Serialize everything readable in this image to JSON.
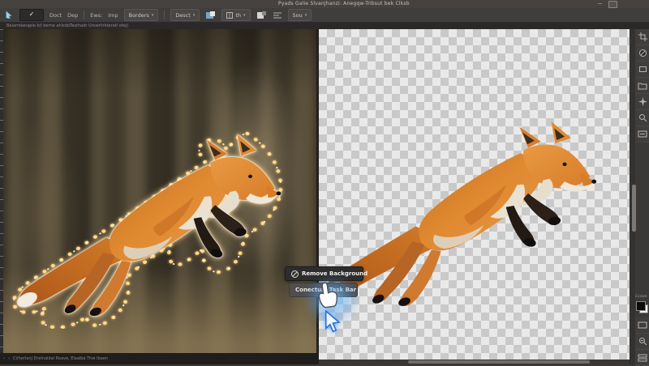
{
  "window": {
    "title": "Pyads Galie Slvanjhanzi: Anegqw-Tribsut bek Clksb",
    "minimize_glyph": "—",
    "maximize_glyph": ""
  },
  "options_bar": {
    "check_glyph": "✓",
    "label_doct": "Doct",
    "label_dep": "Dep",
    "label_ews": "Ews:",
    "label_imp": "Imp",
    "borders_dropdown": "Borders",
    "select_button": "Desct",
    "th_dropdown": "th",
    "sou_dropdown": "Sou",
    "caret": "▾"
  },
  "hint_bar": {
    "text": "Balamdanaple b/l berne ahlstbiTesrhadr Urowrlirkteratl otej)"
  },
  "context_menu": {
    "remove_background_label": "Remove Background",
    "task_bar_label": "Conectual Task Bar"
  },
  "status_bar": {
    "prev_glyph": "‹",
    "next_glyph": "›",
    "text": "Cl/herlanJ Drelnaldal Roave, Elaalba Thw Ibaen"
  },
  "right_panel": {
    "label": "Ecowe"
  },
  "canvas": {
    "left_view": "original photo with glowing selection outline around leaping fox",
    "right_view": "background removed - fox cutout on transparency checkerboard"
  },
  "colors": {
    "selection_dot_gold": "#ffd98a",
    "selection_outline_white": "#ffffff",
    "cursor_glow_blue": "#5aa8ff",
    "checker_light": "#e9e9e9",
    "checker_dark": "#c9c9c9",
    "chrome_dark": "#403e3c"
  }
}
